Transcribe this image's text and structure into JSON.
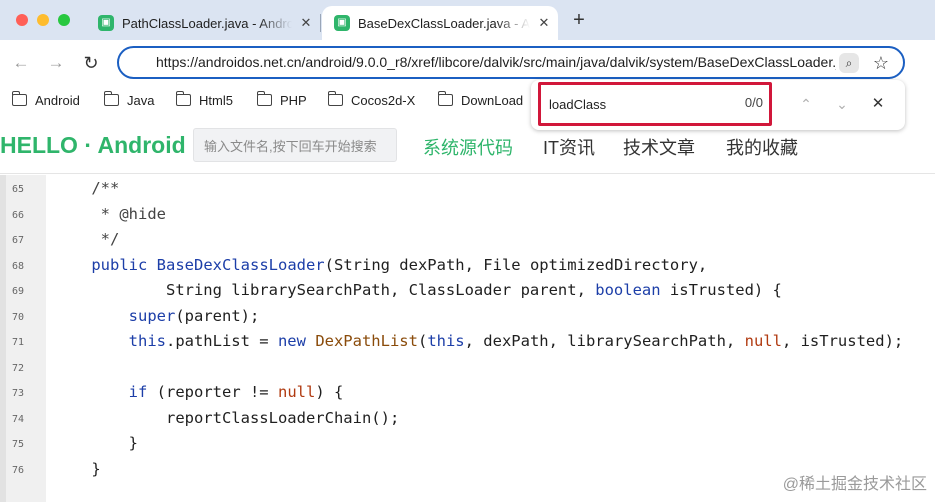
{
  "browser": {
    "tabs": [
      {
        "title": "PathClassLoader.java - Android",
        "active": false
      },
      {
        "title": "BaseDexClassLoader.java - Android",
        "active": true
      }
    ],
    "new_tab_label": "+",
    "url": "https://androidos.net.cn/android/9.0.0_r8/xref/libcore/dalvik/src/main/java/dalvik/system/BaseDexClassLoader.java",
    "bookmarks": [
      "Android",
      "Java",
      "Html5",
      "PHP",
      "Cocos2d-X",
      "DownLoad"
    ]
  },
  "find": {
    "query": "loadClass",
    "count": "0/0"
  },
  "site": {
    "logo": "HELLO · Android",
    "search_placeholder": "输入文件名,按下回车开始搜索",
    "nav": [
      "系统源代码",
      "IT资讯",
      "技术文章",
      "我的收藏"
    ]
  },
  "code": {
    "lines": [
      {
        "n": "65",
        "segs": [
          {
            "t": "    /**",
            "c": "comment"
          }
        ]
      },
      {
        "n": "66",
        "segs": [
          {
            "t": "     * @hide",
            "c": "comment"
          }
        ]
      },
      {
        "n": "67",
        "segs": [
          {
            "t": "     */",
            "c": "comment"
          }
        ]
      },
      {
        "n": "68",
        "segs": [
          {
            "t": "    ",
            "c": ""
          },
          {
            "t": "public",
            "c": "kw"
          },
          {
            "t": " ",
            "c": ""
          },
          {
            "t": "BaseDexClassLoader",
            "c": "type"
          },
          {
            "t": "(String dexPath, File optimizedDirectory,",
            "c": ""
          }
        ]
      },
      {
        "n": "69",
        "segs": [
          {
            "t": "            String librarySearchPath, ClassLoader parent, ",
            "c": ""
          },
          {
            "t": "boolean",
            "c": "kw"
          },
          {
            "t": " isTrusted) {",
            "c": ""
          }
        ]
      },
      {
        "n": "70",
        "segs": [
          {
            "t": "        ",
            "c": ""
          },
          {
            "t": "super",
            "c": "kw"
          },
          {
            "t": "(parent);",
            "c": ""
          }
        ]
      },
      {
        "n": "71",
        "segs": [
          {
            "t": "        ",
            "c": ""
          },
          {
            "t": "this",
            "c": "kw"
          },
          {
            "t": ".pathList = ",
            "c": ""
          },
          {
            "t": "new",
            "c": "kw"
          },
          {
            "t": " ",
            "c": ""
          },
          {
            "t": "DexPathList",
            "c": "call"
          },
          {
            "t": "(",
            "c": ""
          },
          {
            "t": "this",
            "c": "kw"
          },
          {
            "t": ", dexPath, librarySearchPath, ",
            "c": ""
          },
          {
            "t": "null",
            "c": "lit"
          },
          {
            "t": ", isTrusted);",
            "c": ""
          }
        ]
      },
      {
        "n": "72",
        "segs": []
      },
      {
        "n": "73",
        "segs": [
          {
            "t": "        ",
            "c": ""
          },
          {
            "t": "if",
            "c": "kw"
          },
          {
            "t": " (reporter != ",
            "c": ""
          },
          {
            "t": "null",
            "c": "lit"
          },
          {
            "t": ") {",
            "c": ""
          }
        ]
      },
      {
        "n": "74",
        "segs": [
          {
            "t": "            reportClassLoaderChain();",
            "c": ""
          }
        ]
      },
      {
        "n": "75",
        "segs": [
          {
            "t": "        }",
            "c": ""
          }
        ]
      },
      {
        "n": "76",
        "segs": [
          {
            "t": "    }",
            "c": ""
          }
        ]
      }
    ]
  },
  "watermark": "@稀土掘金技术社区",
  "colors": {
    "accent": "#2fb56b",
    "focus_ring": "#1b5fc2",
    "find_highlight": "#d1173a"
  }
}
